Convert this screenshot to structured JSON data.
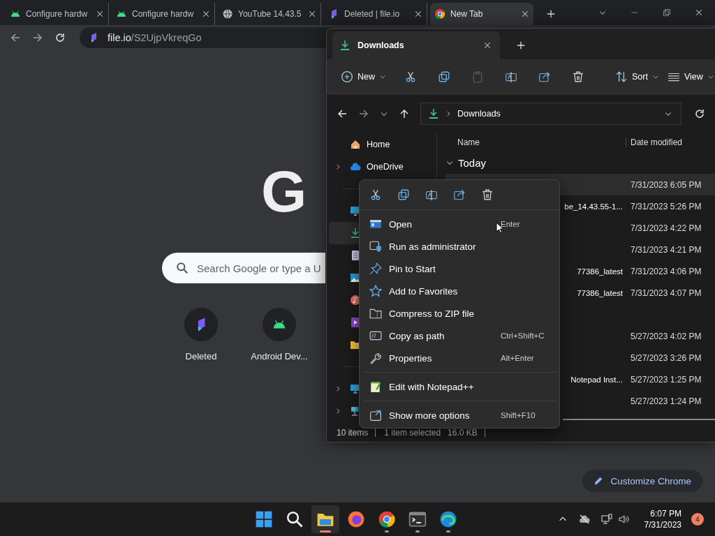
{
  "browser": {
    "tabs": [
      {
        "kind": "android",
        "title": "Configure hardw",
        "selected": false
      },
      {
        "kind": "android",
        "title": "Configure hardw",
        "selected": false
      },
      {
        "kind": "globe",
        "title": "YouTube 14.43.5",
        "selected": false
      },
      {
        "kind": "fileio",
        "title": "Deleted | file.io",
        "selected": false
      },
      {
        "kind": "chrome",
        "title": "New Tab",
        "selected": true
      }
    ],
    "address": {
      "host": "file.io",
      "path": "/S2UjpVkreqGo"
    },
    "logo": "G",
    "search": {
      "placeholder": "Search Google or type a U"
    },
    "shortcuts": [
      {
        "kind": "fileio",
        "label": "Deleted"
      },
      {
        "kind": "android",
        "label": "Android Dev..."
      }
    ],
    "customize": "Customize Chrome"
  },
  "explorer": {
    "tab": "Downloads",
    "toolbar": {
      "new": "New",
      "sort": "Sort",
      "view": "View"
    },
    "path": "Downloads",
    "nav": [
      {
        "label": "Home",
        "expandable": false
      },
      {
        "label": "OneDrive",
        "expandable": true
      }
    ],
    "quick_access": [
      {
        "selected": false
      },
      {
        "selected": true
      },
      {
        "selected": false
      },
      {
        "selected": false
      },
      {
        "selected": false
      },
      {
        "selected": false
      },
      {
        "selected": false
      }
    ],
    "nav_bottom": [
      {
        "expandable": true
      },
      {
        "expandable": true
      }
    ],
    "columns": [
      "Name",
      "Date modified"
    ],
    "group": "Today",
    "rows": [
      {
        "kind": "file",
        "date": "7/31/2023 6:05 PM",
        "selected": true
      },
      {
        "kind": "file",
        "name": "be_14.43.55-1...",
        "date": "7/31/2023 5:26 PM",
        "selected": false
      },
      {
        "kind": "file",
        "date": "7/31/2023 4:22 PM",
        "selected": false
      },
      {
        "kind": "file",
        "date": "7/31/2023 4:21 PM",
        "selected": false
      },
      {
        "kind": "file",
        "name": "77386_latest",
        "date": "7/31/2023 4:06 PM",
        "selected": false
      },
      {
        "kind": "file",
        "name": "77386_latest",
        "date": "7/31/2023 4:07 PM",
        "selected": false
      },
      {
        "kind": "group"
      },
      {
        "kind": "file",
        "date": "5/27/2023 4:02 PM",
        "selected": false
      },
      {
        "kind": "file",
        "date": "5/27/2023 3:26 PM",
        "selected": false
      },
      {
        "kind": "file",
        "name": "Notepad Inst...",
        "date": "5/27/2023 1:25 PM",
        "selected": false
      },
      {
        "kind": "file",
        "date": "5/27/2023 1:24 PM",
        "selected": false
      }
    ],
    "status": {
      "count": "10 items",
      "selection": "1 item selected",
      "size": "16.0 KB"
    }
  },
  "context_menu": {
    "sections": [
      [
        {
          "label": "Open",
          "shortcut": "Enter"
        },
        {
          "label": "Run as administrator"
        },
        {
          "label": "Pin to Start"
        },
        {
          "label": "Add to Favorites"
        },
        {
          "label": "Compress to ZIP file"
        },
        {
          "label": "Copy as path",
          "shortcut": "Ctrl+Shift+C"
        },
        {
          "label": "Properties",
          "shortcut": "Alt+Enter"
        }
      ],
      [
        {
          "label": "Edit with Notepad++"
        }
      ],
      [
        {
          "label": "Show more options",
          "shortcut": "Shift+F10"
        }
      ]
    ]
  },
  "taskbar": {
    "apps": [
      {
        "kind": "start",
        "active": false,
        "running": false
      },
      {
        "kind": "search",
        "active": false,
        "running": false
      },
      {
        "kind": "explorer",
        "active": true,
        "running": true
      },
      {
        "kind": "firefox",
        "active": false,
        "running": false
      },
      {
        "kind": "chrome",
        "active": false,
        "running": true
      },
      {
        "kind": "terminal",
        "active": false,
        "running": true
      },
      {
        "kind": "edge",
        "active": false,
        "running": true
      }
    ],
    "time": "6:07 PM",
    "date": "7/31/2023",
    "badge": "4"
  }
}
